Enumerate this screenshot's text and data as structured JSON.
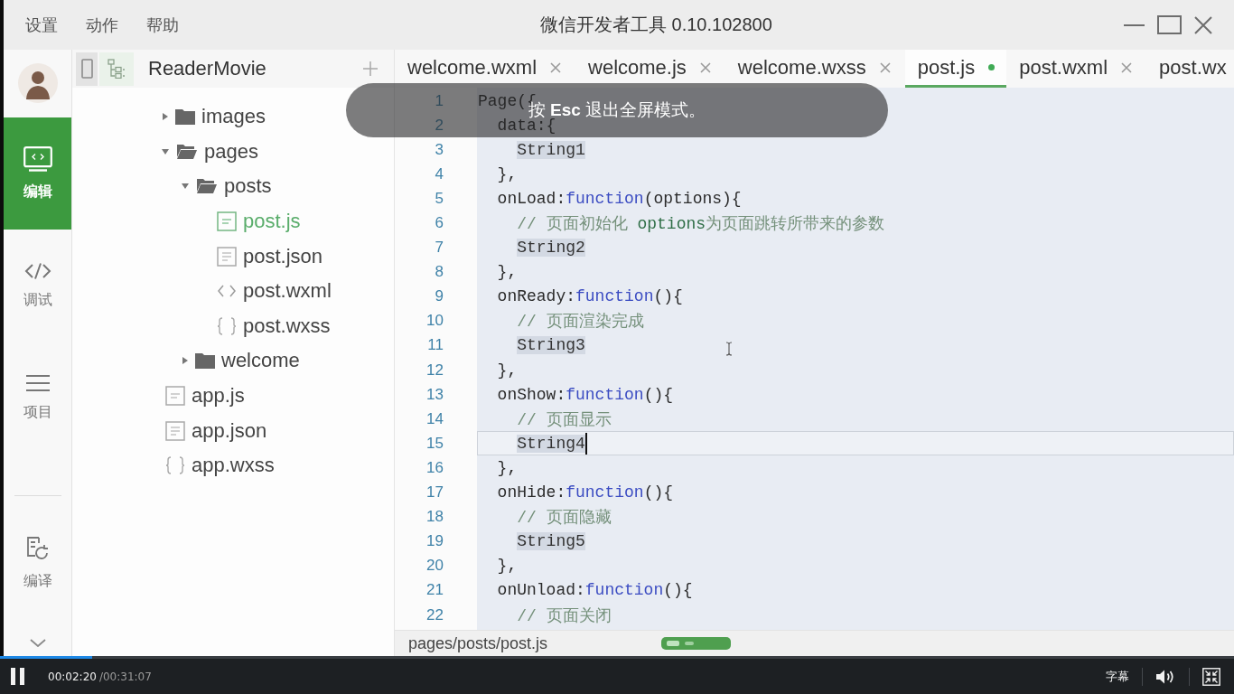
{
  "window": {
    "menu": [
      "设置",
      "动作",
      "帮助"
    ],
    "title": "微信开发者工具 0.10.102800"
  },
  "nav": [
    {
      "label": "编辑",
      "selected": true
    },
    {
      "label": "调试",
      "selected": false
    },
    {
      "label": "项目",
      "selected": false
    }
  ],
  "nav_bottom": [
    {
      "label": "编译",
      "selected": false
    }
  ],
  "project": {
    "name": "ReaderMovie"
  },
  "tree": [
    {
      "name": "images",
      "kind": "folder",
      "expanded": false,
      "selected": false
    },
    {
      "name": "pages",
      "kind": "folder",
      "expanded": true,
      "selected": false,
      "children": [
        {
          "name": "posts",
          "kind": "folder",
          "expanded": true,
          "selected": false,
          "children": [
            {
              "name": "post.js",
              "kind": "js",
              "selected": true
            },
            {
              "name": "post.json",
              "kind": "json",
              "selected": false
            },
            {
              "name": "post.wxml",
              "kind": "wxml",
              "selected": false
            },
            {
              "name": "post.wxss",
              "kind": "wxss",
              "selected": false
            }
          ]
        },
        {
          "name": "welcome",
          "kind": "folder",
          "expanded": false,
          "selected": false
        }
      ]
    },
    {
      "name": "app.js",
      "kind": "js",
      "selected": false
    },
    {
      "name": "app.json",
      "kind": "json",
      "selected": false
    },
    {
      "name": "app.wxss",
      "kind": "wxss",
      "selected": false
    }
  ],
  "tabs": [
    {
      "label": "welcome.wxml",
      "selected": false,
      "modified": false
    },
    {
      "label": "welcome.js",
      "selected": false,
      "modified": false
    },
    {
      "label": "welcome.wxss",
      "selected": false,
      "modified": false
    },
    {
      "label": "post.js",
      "selected": true,
      "modified": true
    },
    {
      "label": "post.wxml",
      "selected": false,
      "modified": false
    }
  ],
  "clipped_tab": {
    "label": "post.wx"
  },
  "editor": {
    "lines": [
      {
        "number": "1",
        "current": false,
        "tokens": [
          {
            "text": "Page({",
            "kind": "plain"
          }
        ],
        "children": [
          {
            "number": "2",
            "current": false,
            "tokens": [
              {
                "text": "data:{",
                "kind": "plain"
              }
            ],
            "children": [
              {
                "number": "3",
                "current": false,
                "tokens": [
                  {
                    "text": "String1",
                    "kind": "placeholder"
                  }
                ]
              }
            ]
          },
          {
            "number": "4",
            "current": false,
            "tokens": [
              {
                "text": "},",
                "kind": "plain"
              }
            ]
          },
          {
            "number": "5",
            "current": false,
            "tokens": [
              {
                "text": "onLoad:",
                "kind": "plain"
              },
              {
                "text": "function",
                "kind": "keyword"
              },
              {
                "text": "(options){",
                "kind": "plain"
              }
            ],
            "children": [
              {
                "number": "6",
                "current": false,
                "tokens": [
                  {
                    "text": "// 页面初始化 ",
                    "kind": "comment"
                  },
                  {
                    "text": "options",
                    "kind": "comment_term"
                  },
                  {
                    "text": "为页面跳转所带来的参数",
                    "kind": "comment"
                  }
                ]
              },
              {
                "number": "7",
                "current": false,
                "tokens": [
                  {
                    "text": "String2",
                    "kind": "placeholder"
                  }
                ]
              }
            ]
          },
          {
            "number": "8",
            "current": false,
            "tokens": [
              {
                "text": "},",
                "kind": "plain"
              }
            ]
          },
          {
            "number": "9",
            "current": false,
            "tokens": [
              {
                "text": "onReady:",
                "kind": "plain"
              },
              {
                "text": "function",
                "kind": "keyword"
              },
              {
                "text": "(){",
                "kind": "plain"
              }
            ],
            "children": [
              {
                "number": "10",
                "current": false,
                "tokens": [
                  {
                    "text": "// 页面渲染完成",
                    "kind": "comment"
                  }
                ]
              },
              {
                "number": "11",
                "current": false,
                "tokens": [
                  {
                    "text": "String3",
                    "kind": "placeholder"
                  }
                ]
              }
            ]
          },
          {
            "number": "12",
            "current": false,
            "tokens": [
              {
                "text": "},",
                "kind": "plain"
              }
            ]
          },
          {
            "number": "13",
            "current": false,
            "tokens": [
              {
                "text": "onShow:",
                "kind": "plain"
              },
              {
                "text": "function",
                "kind": "keyword"
              },
              {
                "text": "(){",
                "kind": "plain"
              }
            ],
            "children": [
              {
                "number": "14",
                "current": false,
                "tokens": [
                  {
                    "text": "// 页面显示",
                    "kind": "comment"
                  }
                ]
              },
              {
                "number": "15",
                "current": true,
                "tokens": [
                  {
                    "text": "String4",
                    "kind": "placeholder"
                  }
                ]
              }
            ]
          },
          {
            "number": "16",
            "current": false,
            "tokens": [
              {
                "text": "},",
                "kind": "plain"
              }
            ]
          },
          {
            "number": "17",
            "current": false,
            "tokens": [
              {
                "text": "onHide:",
                "kind": "plain"
              },
              {
                "text": "function",
                "kind": "keyword"
              },
              {
                "text": "(){",
                "kind": "plain"
              }
            ],
            "children": [
              {
                "number": "18",
                "current": false,
                "tokens": [
                  {
                    "text": "// 页面隐藏",
                    "kind": "comment"
                  }
                ]
              },
              {
                "number": "19",
                "current": false,
                "tokens": [
                  {
                    "text": "String5",
                    "kind": "placeholder"
                  }
                ]
              }
            ]
          },
          {
            "number": "20",
            "current": false,
            "tokens": [
              {
                "text": "},",
                "kind": "plain"
              }
            ]
          },
          {
            "number": "21",
            "current": false,
            "tokens": [
              {
                "text": "onUnload:",
                "kind": "plain"
              },
              {
                "text": "function",
                "kind": "keyword"
              },
              {
                "text": "(){",
                "kind": "plain"
              }
            ],
            "children": [
              {
                "number": "22",
                "current": false,
                "tokens": [
                  {
                    "text": "// 页面关闭",
                    "kind": "comment"
                  }
                ]
              }
            ]
          }
        ]
      }
    ]
  },
  "status_bar": {
    "path": "pages/posts/post.js"
  },
  "notice": {
    "text": "按 **Esc** 退出全屏模式。"
  },
  "player": {
    "level": 0.075,
    "playing": true,
    "elapsed": "00:02:20",
    "duration": "/00:31:07",
    "subtitles": "字幕"
  }
}
